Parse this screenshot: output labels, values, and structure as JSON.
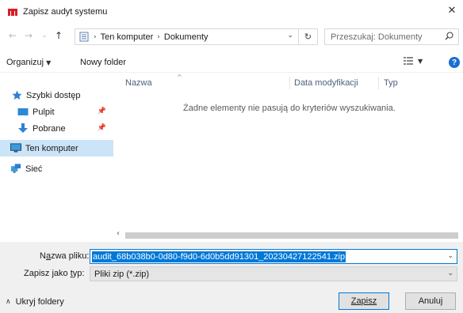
{
  "window": {
    "title": "Zapisz audyt systemu",
    "close_glyph": "✕"
  },
  "nav": {
    "back_glyph": "←",
    "forward_glyph": "→",
    "recent_glyph": "⌄",
    "up_glyph": "↑",
    "breadcrumbs": [
      "Ten komputer",
      "Dokumenty"
    ],
    "crumb_sep": "›",
    "dropdown_glyph": "⌄",
    "refresh_glyph": "↻",
    "search_placeholder": "Przeszukaj: Dokumenty"
  },
  "toolbar": {
    "organize_label": "Organizuj",
    "new_folder_label": "Nowy folder"
  },
  "sidebar": {
    "items": [
      {
        "label": "Szybki dostęp",
        "icon": "star-icon"
      },
      {
        "label": "Pulpit",
        "icon": "desktop-icon",
        "pinned": true
      },
      {
        "label": "Pobrane",
        "icon": "download-icon",
        "pinned": true
      },
      {
        "label": "Ten komputer",
        "icon": "computer-icon",
        "selected": true
      },
      {
        "label": "Sieć",
        "icon": "network-icon"
      }
    ]
  },
  "filepane": {
    "columns": [
      "Nazwa",
      "Data modyfikacji",
      "Typ"
    ],
    "empty_message": "Żadne elementy nie pasują do kryteriów wyszukiwania."
  },
  "bottom": {
    "filename_label_pre": "N",
    "filename_label_u": "a",
    "filename_label_post": "zwa pliku:",
    "filename_value": "audit_68b038b0-0d80-f9d0-6d0b5dd91301_20230427122541.zip",
    "type_label_pre": "Zapisz jako ",
    "type_label_u": "t",
    "type_label_post": "yp:",
    "type_value": "Pliki zip (*.zip)",
    "hide_folders_label": "Ukryj foldery",
    "save_label": "Zapisz",
    "cancel_label": "Anuluj"
  },
  "colors": {
    "accent": "#0078d7",
    "selected_bg": "#cce4f7",
    "logo_red": "#d71f26"
  }
}
